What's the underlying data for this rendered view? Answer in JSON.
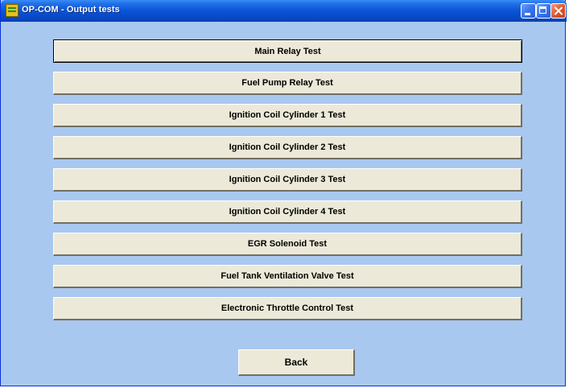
{
  "window": {
    "title": "OP-COM - Output tests",
    "app_icon": "opcom-app-icon",
    "controls": {
      "minimize": "minimize-icon",
      "maximize": "maximize-icon",
      "close": "close-icon"
    }
  },
  "tests": [
    {
      "label": "Main Relay Test",
      "focused": true
    },
    {
      "label": "Fuel Pump Relay Test"
    },
    {
      "label": "Ignition Coil Cylinder 1 Test"
    },
    {
      "label": "Ignition Coil Cylinder 2 Test"
    },
    {
      "label": "Ignition Coil Cylinder 3 Test"
    },
    {
      "label": "Ignition Coil Cylinder 4 Test"
    },
    {
      "label": "EGR Solenoid Test"
    },
    {
      "label": "Fuel Tank Ventilation Valve Test"
    },
    {
      "label": "Electronic Throttle Control Test"
    }
  ],
  "footer": {
    "back_label": "Back"
  },
  "colors": {
    "client_background": "#a9c8f0",
    "button_face": "#ece9d8",
    "titlebar": "#0a54d8",
    "close_button": "#e0592f"
  }
}
